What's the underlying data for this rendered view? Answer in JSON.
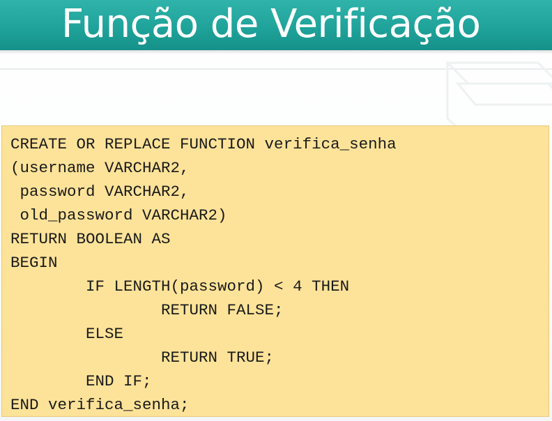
{
  "slide": {
    "title": "Função de Verificação",
    "code_lines": [
      "CREATE OR REPLACE FUNCTION verifica_senha",
      "(username VARCHAR2,",
      " password VARCHAR2,",
      " old_password VARCHAR2)",
      "RETURN BOOLEAN AS",
      "BEGIN",
      "        IF LENGTH(password) < 4 THEN",
      "                RETURN FALSE;",
      "        ELSE",
      "                RETURN TRUE;",
      "        END IF;",
      "END verifica_senha;"
    ]
  },
  "colors": {
    "title_bar": "#1fa39a",
    "title_text": "#ffffff",
    "code_background": "#fde399",
    "code_text": "#1a1a1a"
  }
}
